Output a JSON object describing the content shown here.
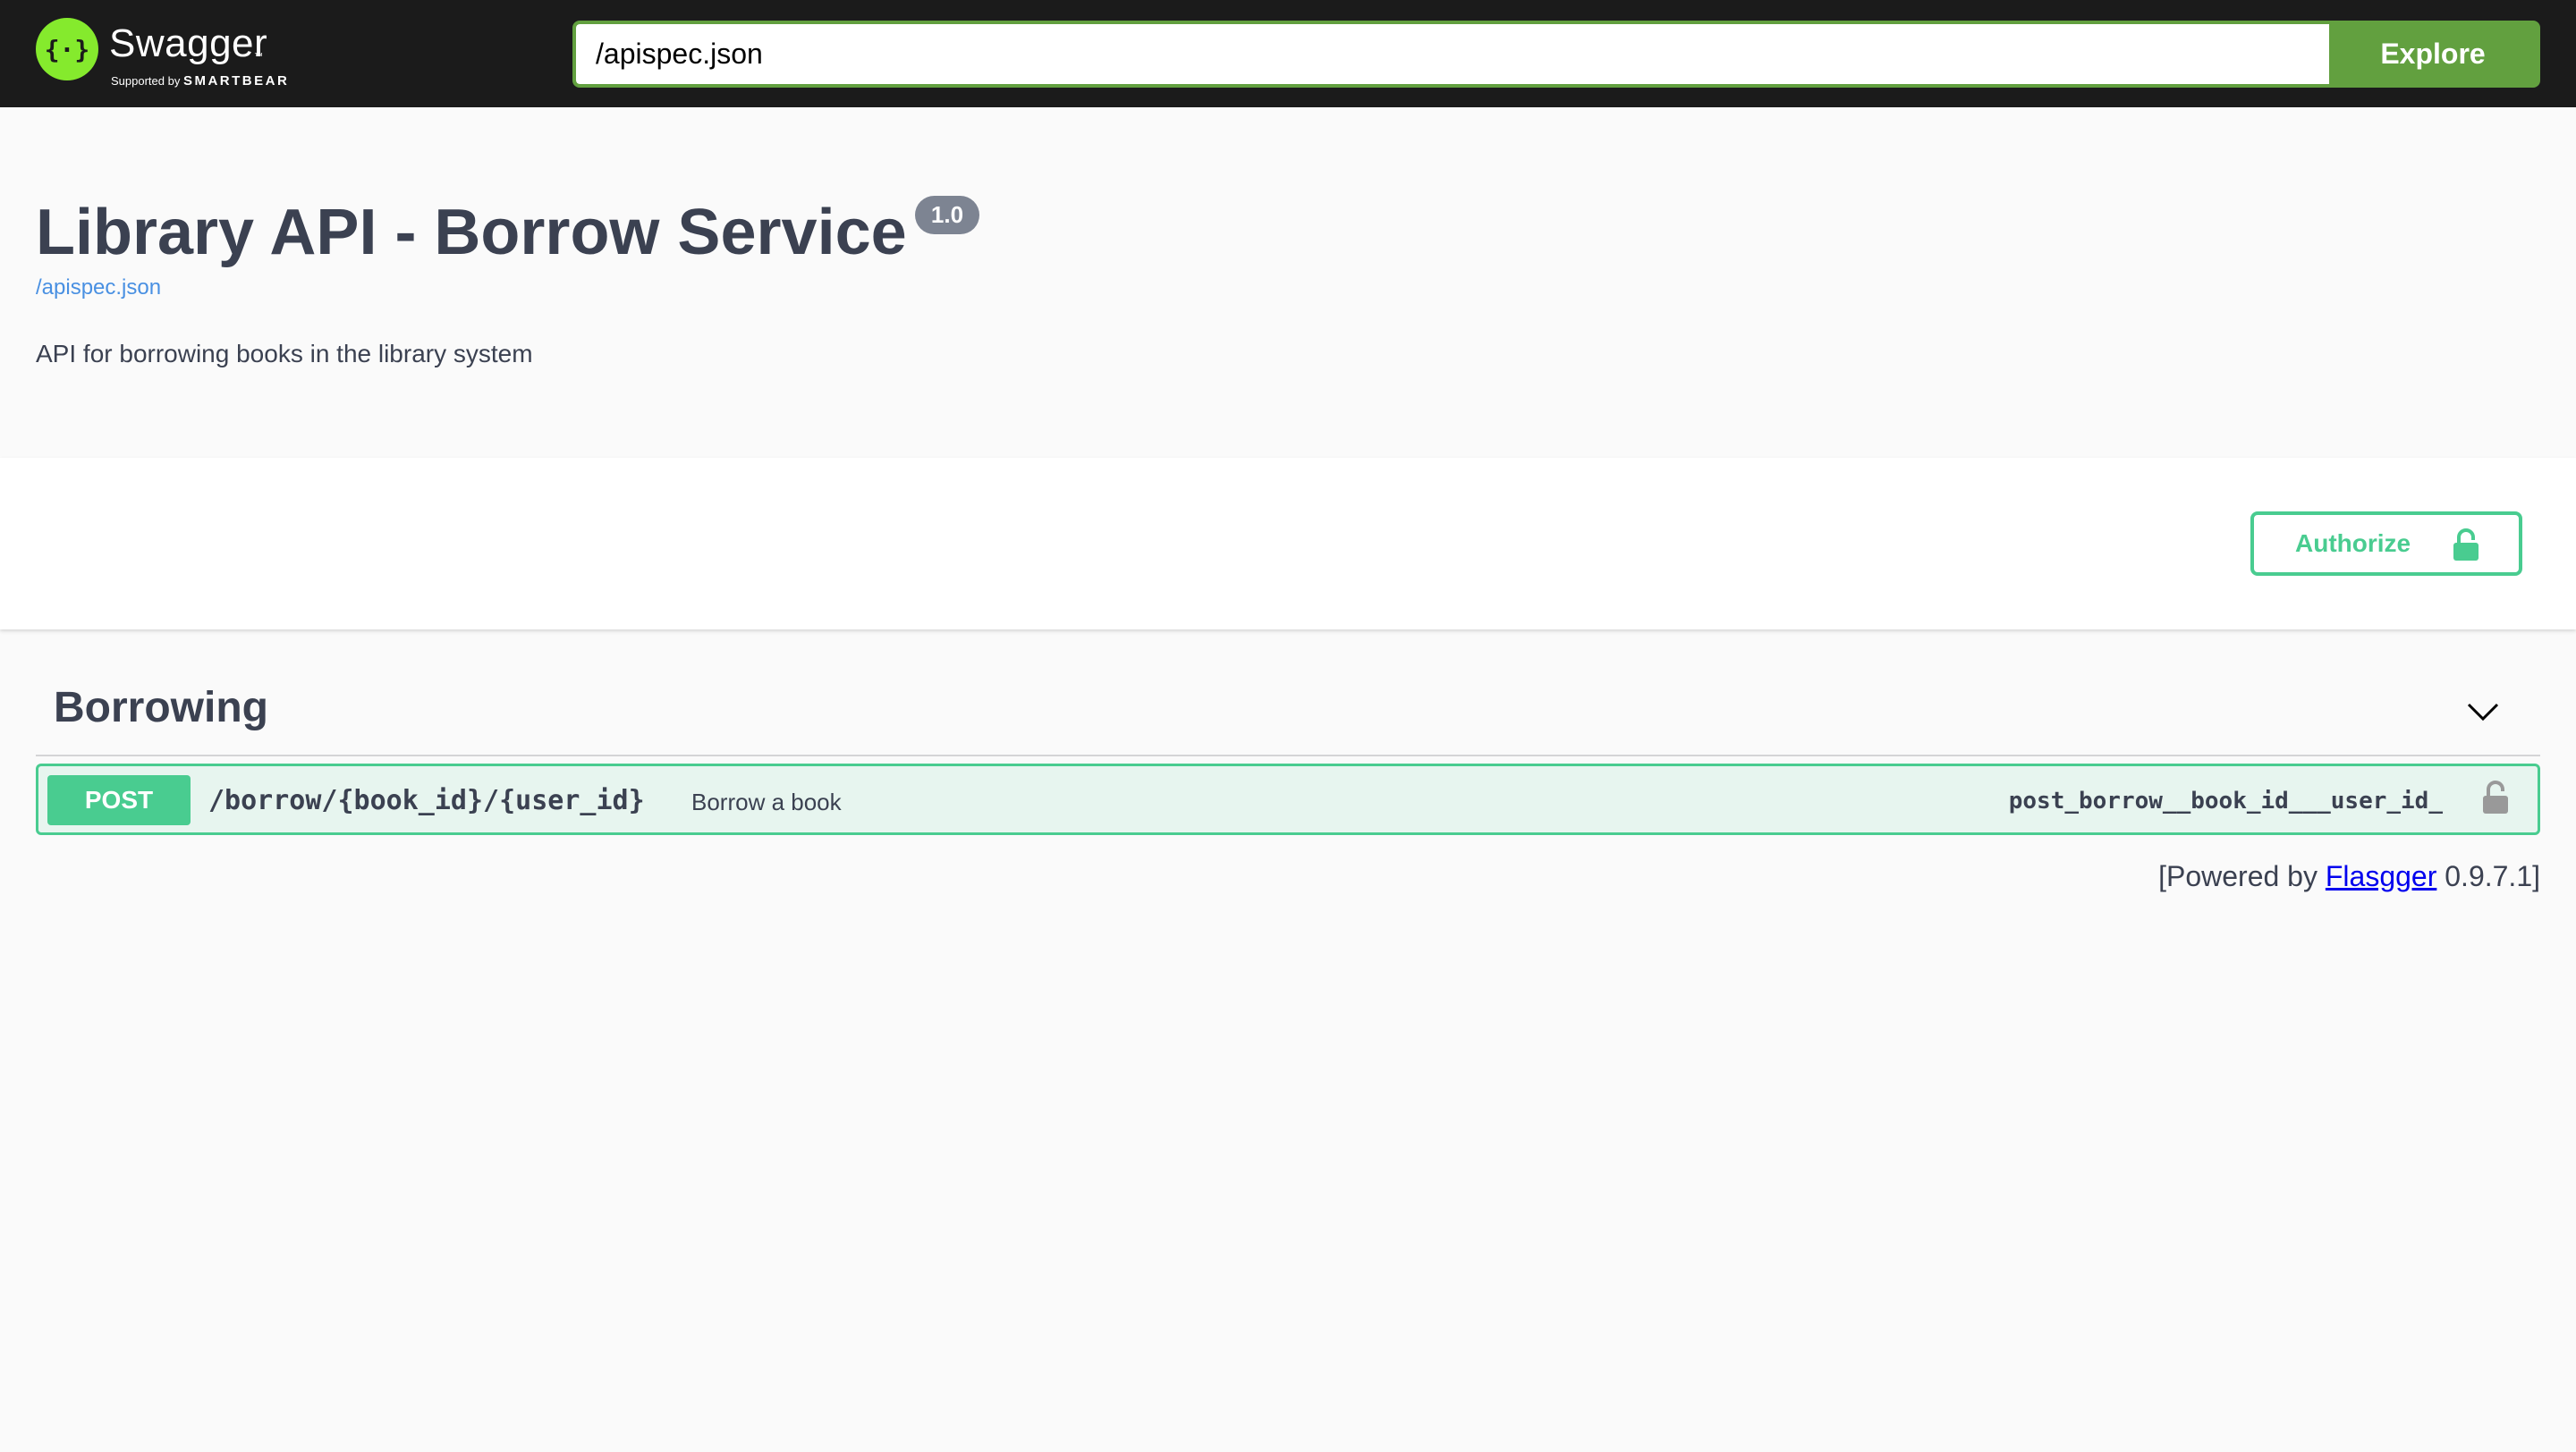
{
  "topbar": {
    "brand": "Swagger",
    "tm": "™",
    "supported_by": "Supported by",
    "smartbear": "SMARTBEAR",
    "logo_icon": "swagger-braces-icon",
    "url_value": "/apispec.json",
    "explore_label": "Explore"
  },
  "info": {
    "title": "Library API - Borrow Service",
    "version": "1.0",
    "spec_link": "/apispec.json",
    "description": "API for borrowing books in the library system"
  },
  "scheme": {
    "authorize_label": "Authorize",
    "authorize_icon": "lock-icon"
  },
  "tags": [
    {
      "name": "Borrowing",
      "toggle_icon": "chevron-down-icon",
      "operations": [
        {
          "method": "POST",
          "path": "/borrow/{book_id}/{user_id}",
          "summary": "Borrow a book",
          "operation_id": "post_borrow__book_id___user_id_",
          "lock_icon": "lock-icon"
        }
      ]
    }
  ],
  "footer": {
    "prefix": "[Powered by ",
    "link": "Flasgger",
    "suffix": " 0.9.7.1]"
  },
  "colors": {
    "topbar_bg": "#1b1b1b",
    "logo_green": "#85ea2d",
    "explore_green": "#62a03f",
    "post_green": "#49cc90",
    "text": "#3b4151",
    "link": "#4990e2",
    "badge": "#7d8492"
  }
}
